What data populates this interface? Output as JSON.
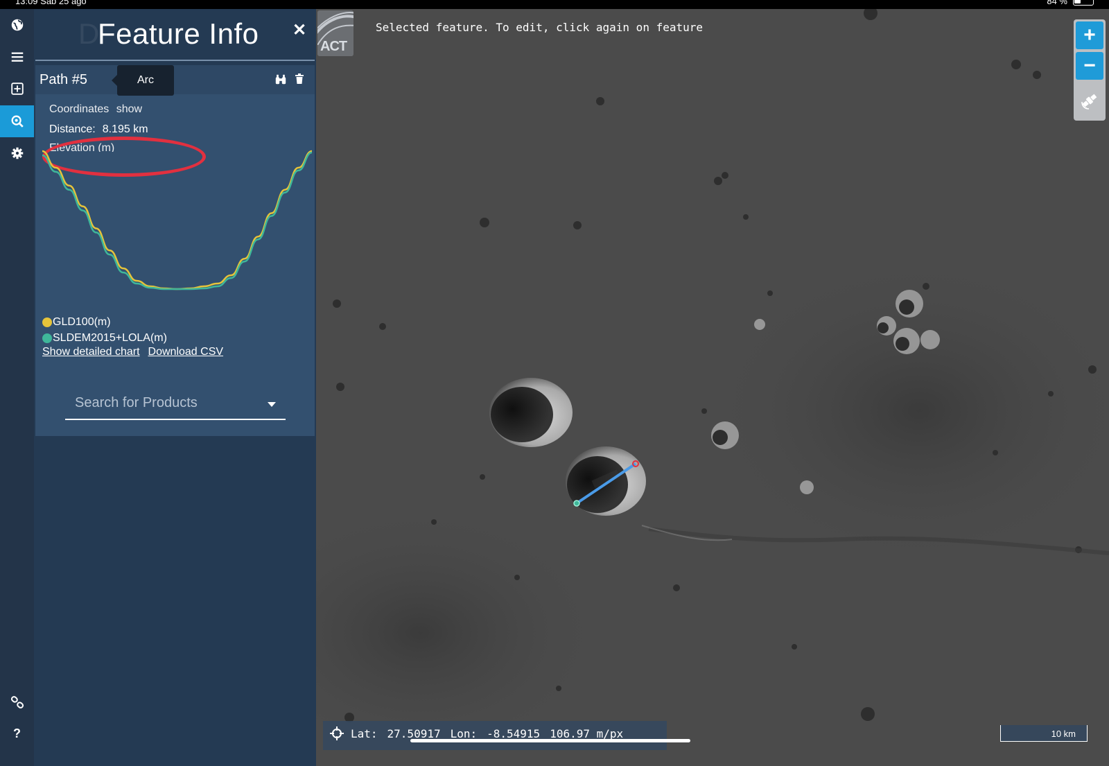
{
  "status_bar": {
    "left_text": "13:09  Sab 25 ago",
    "right_text": "84 %"
  },
  "rail": {
    "icons": [
      "globe-icon",
      "menu-icon",
      "add-layer-icon",
      "search-feature-icon",
      "gear-icon",
      "link-icon",
      "help-icon"
    ],
    "help_label": "?"
  },
  "panel": {
    "title": "Feature Info",
    "title_ghost": "D",
    "close_label": "✕",
    "feature": {
      "name": "Path #5",
      "tooltip": "Arc",
      "coordinates_label": "Coordinates",
      "coordinates_link": "show",
      "distance_label": "Distance:",
      "distance_value": "8.195 km",
      "elevation_label": "Elevation (m)"
    },
    "legend": [
      {
        "label": "GLD100(m)",
        "color": "#e6c43a"
      },
      {
        "label": "SLDEM2015+LOLA(m)",
        "color": "#3fb79a"
      }
    ],
    "links": {
      "detailed_chart": "Show detailed chart",
      "download_csv": "Download CSV"
    },
    "search": {
      "placeholder": "Search for Products"
    }
  },
  "map": {
    "logo_text": "ACT",
    "message": "Selected feature. To edit, click again on feature",
    "zoom_in": "+",
    "zoom_out": "−",
    "coords": {
      "lat_label": "Lat:",
      "lat": "27.50917",
      "lon_label": "Lon:",
      "lon": "-8.54915",
      "scale": "106.97 m/px"
    },
    "scalebar": "10 km"
  },
  "colors": {
    "accent": "#1b9bd8",
    "panel": "#243a53",
    "card": "#33506f",
    "highlight_ring": "#e2303f",
    "path_line": "#4a9be8"
  },
  "chart_data": {
    "type": "line",
    "title": "",
    "xlabel": "",
    "ylabel": "Elevation (m)",
    "x": [
      0,
      0.05,
      0.1,
      0.15,
      0.2,
      0.25,
      0.3,
      0.35,
      0.4,
      0.45,
      0.5,
      0.55,
      0.6,
      0.65,
      0.7,
      0.75,
      0.8,
      0.85,
      0.9,
      0.95,
      1.0
    ],
    "series": [
      {
        "name": "GLD100(m)",
        "color": "#e6c43a",
        "values": [
          100,
          88,
          75,
          60,
          44,
          28,
          15,
          6,
          2,
          0.5,
          0,
          0.5,
          2,
          4,
          10,
          22,
          38,
          55,
          72,
          88,
          100
        ]
      },
      {
        "name": "SLDEM2015+LOLA(m)",
        "color": "#3fb79a",
        "values": [
          97,
          85,
          72,
          57,
          41,
          25,
          12,
          4,
          1,
          0,
          0,
          0,
          0.5,
          2,
          8,
          20,
          36,
          53,
          70,
          86,
          99
        ]
      }
    ]
  }
}
